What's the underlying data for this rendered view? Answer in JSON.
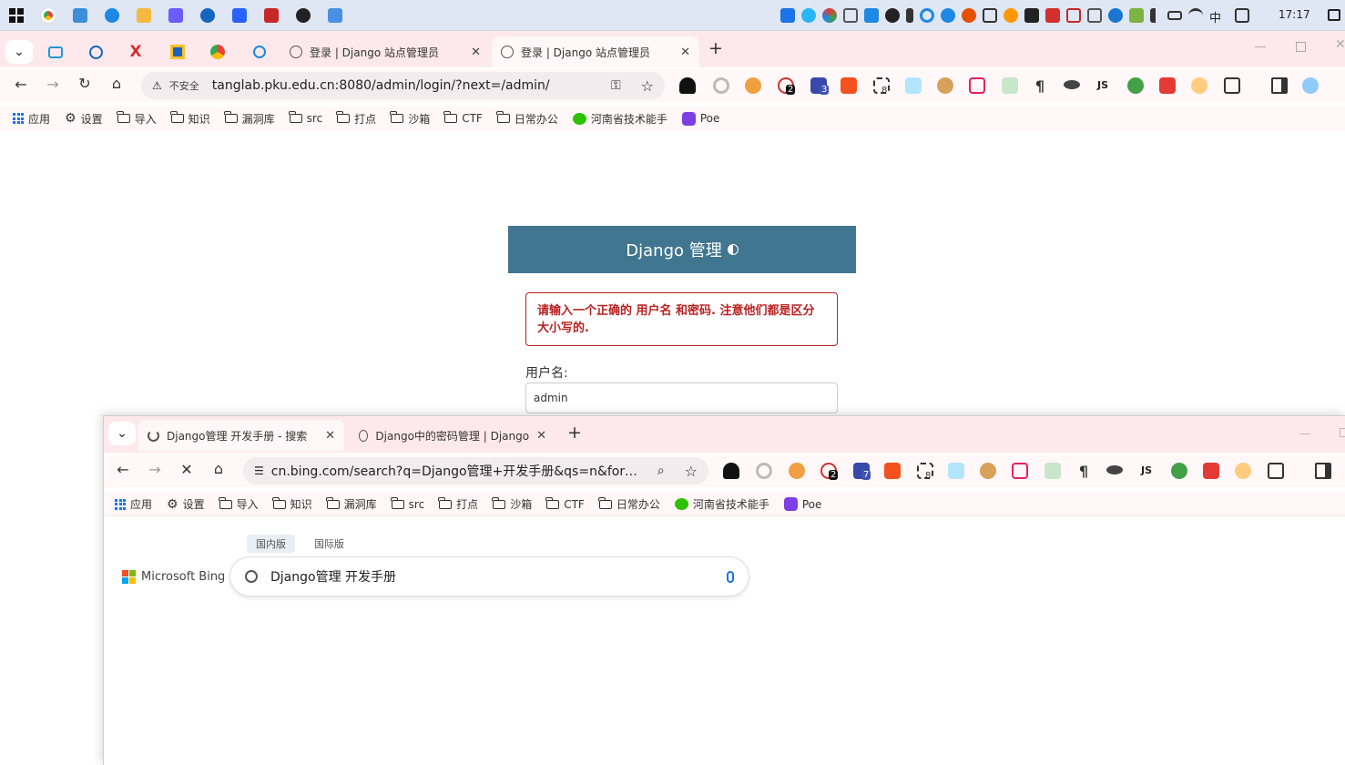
{
  "taskbar": {
    "clock": "17:17",
    "ime": "中"
  },
  "window1": {
    "tabs": [
      {
        "label": "登录 | Django 站点管理员"
      },
      {
        "label": "登录 | Django 站点管理员"
      }
    ],
    "url_warning": "不安全",
    "url": "tanglab.pku.edu.cn:8080/admin/login/?next=/admin/",
    "ext_badges": {
      "b1": "2",
      "b2": "3",
      "b3": "8"
    },
    "ext_js": "JS"
  },
  "bookmarks": [
    {
      "label": "应用"
    },
    {
      "label": "设置"
    },
    {
      "label": "导入"
    },
    {
      "label": "知识"
    },
    {
      "label": "漏洞库"
    },
    {
      "label": "src"
    },
    {
      "label": "打点"
    },
    {
      "label": "沙箱"
    },
    {
      "label": "CTF"
    },
    {
      "label": "日常办公"
    },
    {
      "label": "河南省技术能手"
    },
    {
      "label": "Poe"
    }
  ],
  "django": {
    "header": "Django 管理",
    "error": "请输入一个正确的 用户名 和密码. 注意他们都是区分大小写的.",
    "username_label": "用户名:",
    "username_value": "admin"
  },
  "window2": {
    "tabs": [
      {
        "label": "Django管理 开发手册 - 搜索"
      },
      {
        "label": "Django中的密码管理 | Django"
      }
    ],
    "url": "cn.bing.com/search?q=Django管理+开发手册&qs=n&form=...",
    "ext_badges": {
      "b1": "2",
      "b2": "7",
      "b3": "8"
    },
    "ext_js": "JS"
  },
  "bing": {
    "logo_text": "Microsoft Bing",
    "scope_tabs": [
      "国内版",
      "国际版"
    ],
    "query": "Django管理 开发手册"
  },
  "colors": {
    "django_header": "#417690",
    "error_red": "#ba2121",
    "tab_bg": "#fde9ec"
  }
}
